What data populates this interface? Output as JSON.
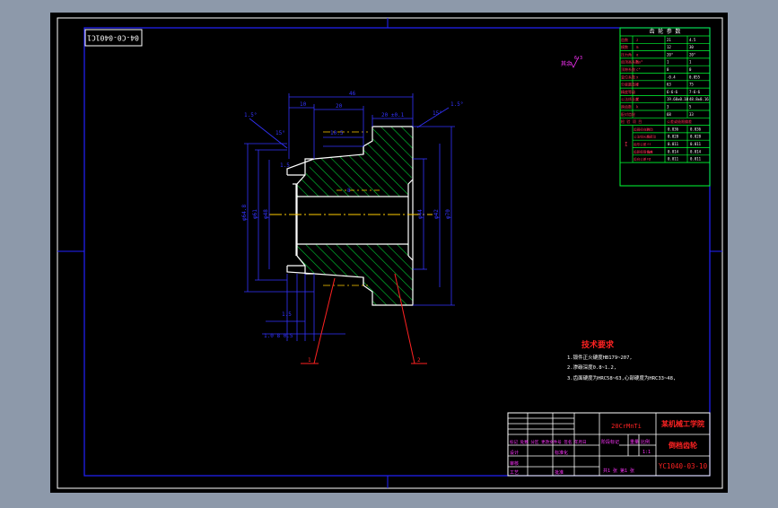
{
  "colors": {
    "background": "#8d99aa",
    "sheet": "#000000",
    "frame": "#ffffff",
    "border": "#2222ff",
    "part": "#ffffff",
    "hatch": "#00cc33",
    "dim": "#3333ff",
    "center": "#ffcc00",
    "leader": "#ff2222",
    "table_text": "#ff3355",
    "title_text": "#ffff00",
    "magenta": "#ff33ff"
  },
  "drawing": {
    "number_box": "04-C0-0401C1",
    "roughness_note": "其余",
    "roughness_value": "6.3",
    "balloons": [
      "1",
      "2"
    ],
    "dims": {
      "top_overall": "46",
      "top_left": "10",
      "top_mid": "20",
      "top_right": "20 ±0.1",
      "chamfer_left": "1.5°",
      "chamfer_right": "1.5°",
      "slope_left": "15°",
      "slope_right": "15°",
      "bore_top": "10.5",
      "bore_mid": "8",
      "dia_outer_left": "φ64.8",
      "dia_left_2": "φ61",
      "dia_left_3": "φ48",
      "dia_right_1": "φ44",
      "dia_right_2": "φ42",
      "dia_right_3": "φ70",
      "chamfer_inner": "1.5",
      "bottom_small": "1.5",
      "bottom_dims": "1.0   8   0.5"
    }
  },
  "parameter_table": {
    "title": "齿 轮 参 数",
    "rows": [
      [
        "齿数",
        "z",
        "21",
        "4.5"
      ],
      [
        "模数",
        "m",
        "12",
        "30"
      ],
      [
        "压力角",
        "α",
        "20°",
        "20°"
      ],
      [
        "齿顶高系数",
        "ha*",
        "1",
        "1"
      ],
      [
        "顶隙系数",
        "c*",
        "0",
        "0"
      ],
      [
        "变位系数",
        "x",
        "-0.4",
        "0.055"
      ],
      [
        "分度圆直径",
        "d",
        "63",
        "75"
      ],
      [
        "精度等级",
        "",
        "6-6-6",
        "7-6-6"
      ],
      [
        "公法线长度",
        "W",
        "19.68±0.10",
        "48.8±0.16"
      ],
      [
        "跨齿数",
        "k",
        "3",
        "5"
      ],
      [
        "配对齿轮",
        "",
        "68",
        "33"
      ]
    ],
    "check_title": "检 验 项 目",
    "check_header": "公差或极限偏差",
    "check_group": "I",
    "check_rows": [
      [
        "齿圈径向跳动",
        "Fr",
        "0.036",
        "0.036"
      ],
      [
        "公法线长度变动",
        "Fw",
        "0.028",
        "0.028"
      ],
      [
        "齿形公差",
        "ff",
        "0.011",
        "0.011"
      ],
      [
        "齿距极限偏差",
        "fpt",
        "0.014",
        "0.014"
      ],
      [
        "齿向公差",
        "Fβ",
        "0.011",
        "0.011"
      ]
    ]
  },
  "tech_requirements": {
    "title": "技术要求",
    "items": [
      "1.锻件正火硬度HB179~207,",
      "2.渗碳深度0.8~1.2,",
      "3.齿面硬度为HRC58~63,心部硬度为HRC33~48,"
    ]
  },
  "title_block": {
    "material": "20CrMnTi",
    "school": "某机械工学院",
    "part_name": "倒档齿轮",
    "drawing_code": "YC1040-03-10",
    "labels_row": "标记 处数 分区 更改文件号 签名 年月日",
    "design_row": "设计",
    "standard": "标准化",
    "stage_label": "阶段标记",
    "weight_label": "重量",
    "scale_label": "比例",
    "scale_value": "1:1",
    "review": "审核",
    "process": "工艺",
    "approve": "批准",
    "sheet_text": "共1 张 第1 张"
  }
}
